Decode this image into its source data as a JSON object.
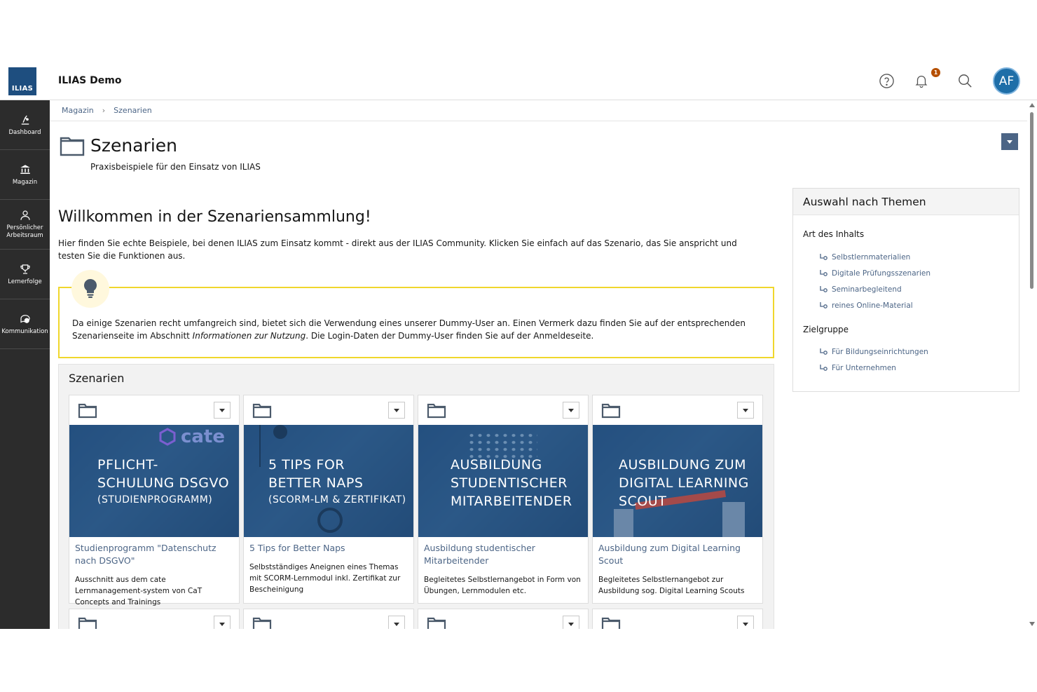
{
  "header": {
    "logo_text": "ILIAS",
    "app_title": "ILIAS Demo",
    "notification_count": "1",
    "avatar_initials": "AF"
  },
  "sidebar": {
    "items": [
      {
        "label": "Dashboard",
        "icon": "dashboard-icon"
      },
      {
        "label": "Magazin",
        "icon": "repository-icon"
      },
      {
        "label": "Persönlicher Arbeitsraum",
        "icon": "person-icon"
      },
      {
        "label": "Lernerfolge",
        "icon": "trophy-icon"
      },
      {
        "label": "Kommunikation",
        "icon": "chat-icon"
      }
    ]
  },
  "breadcrumb": {
    "items": [
      "Magazin",
      "Szenarien"
    ]
  },
  "page": {
    "title": "Szenarien",
    "subtitle": "Praxisbeispiele für den Einsatz von ILIAS",
    "welcome_heading": "Willkommen in der Szenariensammlung!",
    "intro": "Hier finden Sie echte Beispiele, bei denen ILIAS zum Einsatz kommt - direkt aus der ILIAS Community. Klicken Sie einfach auf das Szenario, das Sie anspricht und testen Sie die Funktionen aus.",
    "callout_text_1": "Da einige Szenarien recht umfangreich sind, bietet sich die Verwendung eines unserer Dummy-User an. Einen Vermerk dazu finden Sie auf der entsprechenden Szenari­enseite im Abschnitt ",
    "callout_text_italic": "Informationen zur Nutzung",
    "callout_text_2": ". Die Login-Daten der Dummy-User finden Sie auf der Anmeldeseite."
  },
  "scenarios": {
    "title": "Szenarien",
    "cards": [
      {
        "image_lines": [
          "PFLICHT-",
          "SCHULUNG DSGVO"
        ],
        "image_sub": "(STUDIENPROGRAMM)",
        "image_logo": "cate",
        "title": "Studienprogramm \"Datenschutz nach DSGVO\"",
        "description": "Ausschnitt aus dem cate Lernmanagement-system von CaT Concepts and Trainings"
      },
      {
        "image_lines": [
          "5 TIPS FOR",
          "BETTER NAPS"
        ],
        "image_sub": "(SCORM-LM & ZERTIFIKAT)",
        "title": "5 Tips for Better Naps",
        "description": "Selbstständiges Aneignen eines Themas mit SCORM-Lernmodul inkl. Zertifikat zur Bescheinigung"
      },
      {
        "image_lines": [
          "AUSBILDUNG",
          "STUDENTISCHER",
          "MITARBEITENDER"
        ],
        "image_sub": "",
        "title": "Ausbildung studentischer Mitarbeitender",
        "description": "Begleitetes Selbstlernangebot in Form von Übungen, Lernmodulen etc."
      },
      {
        "image_lines": [
          "AUSBILDUNG ZUM",
          "DIGITAL LEARNING",
          "SCOUT"
        ],
        "image_sub": "",
        "title": "Ausbildung zum Digital Learning Scout",
        "description": "Begleitetes Selbstlernangebot zur Ausbildung sog. Digital Learning Scouts"
      }
    ]
  },
  "themes": {
    "title": "Auswahl nach Themen",
    "groups": [
      {
        "label": "Art des Inhalts",
        "links": [
          "Selbstlernmaterialien",
          "Digitale Prüfungsszenarien",
          "Seminarbegleitend",
          "reines Online-Material"
        ]
      },
      {
        "label": "Zielgruppe",
        "links": [
          "Für Bildungseinrichtungen",
          "Für Unternehmen"
        ]
      }
    ]
  },
  "colors": {
    "link": "#4c6586",
    "sidebar_bg": "#2c2c2c",
    "logo_bg": "#1e4e7f",
    "callout_border": "#f0d72c",
    "badge": "#b54f00"
  }
}
